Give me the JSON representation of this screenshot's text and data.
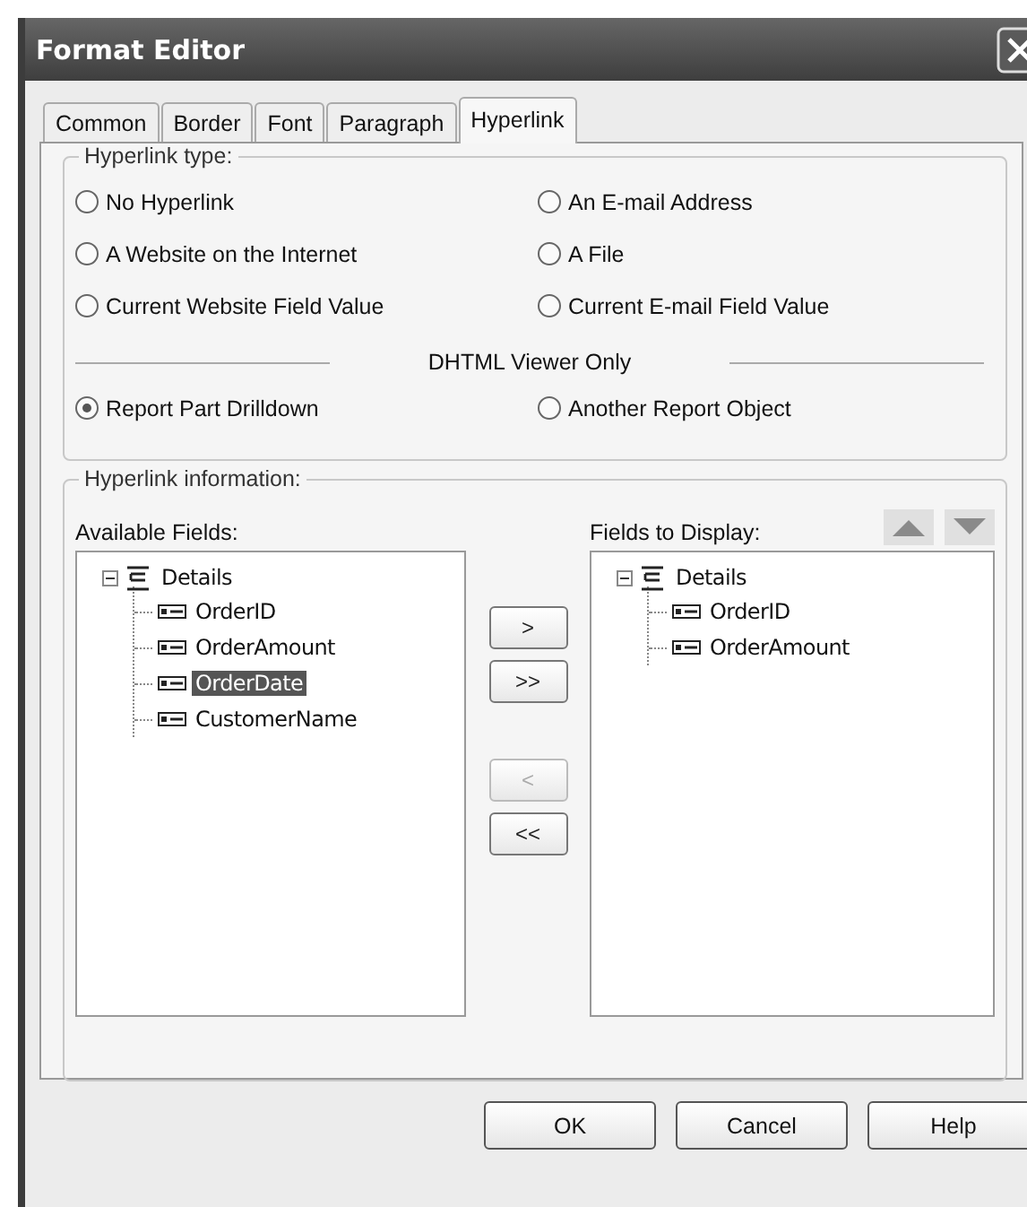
{
  "window": {
    "title": "Format Editor"
  },
  "tabs": [
    {
      "label": "Common",
      "selected": false
    },
    {
      "label": "Border",
      "selected": false
    },
    {
      "label": "Font",
      "selected": false
    },
    {
      "label": "Paragraph",
      "selected": false
    },
    {
      "label": "Hyperlink",
      "selected": true
    }
  ],
  "hyperlink_type": {
    "title": "Hyperlink type:",
    "options": [
      {
        "label": "No Hyperlink",
        "selected": false
      },
      {
        "label": "An E-mail Address",
        "selected": false
      },
      {
        "label": "A Website on the Internet",
        "selected": false
      },
      {
        "label": "A File",
        "selected": false
      },
      {
        "label": "Current Website Field Value",
        "selected": false
      },
      {
        "label": "Current E-mail Field Value",
        "selected": false
      }
    ],
    "divider": "DHTML Viewer Only",
    "viewer_options": [
      {
        "label": "Report Part Drilldown",
        "selected": true
      },
      {
        "label": "Another Report Object",
        "selected": false
      }
    ]
  },
  "hyperlink_information": {
    "title": "Hyperlink information:",
    "available": {
      "label": "Available Fields:",
      "tree": [
        {
          "label": "Details",
          "expanded": true,
          "selected": false,
          "children": [
            {
              "label": "OrderID",
              "selected": false
            },
            {
              "label": "OrderAmount",
              "selected": false
            },
            {
              "label": "OrderDate",
              "selected": true
            },
            {
              "label": "CustomerName",
              "selected": false
            }
          ]
        }
      ]
    },
    "move_buttons": [
      {
        "label": ">",
        "disabled": false
      },
      {
        "label": ">>",
        "disabled": false
      },
      {
        "label": "<",
        "disabled": true
      },
      {
        "label": "<<",
        "disabled": false
      }
    ],
    "display": {
      "label": "Fields to Display:",
      "tree": [
        {
          "label": "Details",
          "expanded": true,
          "selected": false,
          "children": [
            {
              "label": "OrderID",
              "selected": false
            },
            {
              "label": "OrderAmount",
              "selected": false
            }
          ]
        }
      ]
    }
  },
  "buttons": [
    "OK",
    "Cancel",
    "Help"
  ]
}
